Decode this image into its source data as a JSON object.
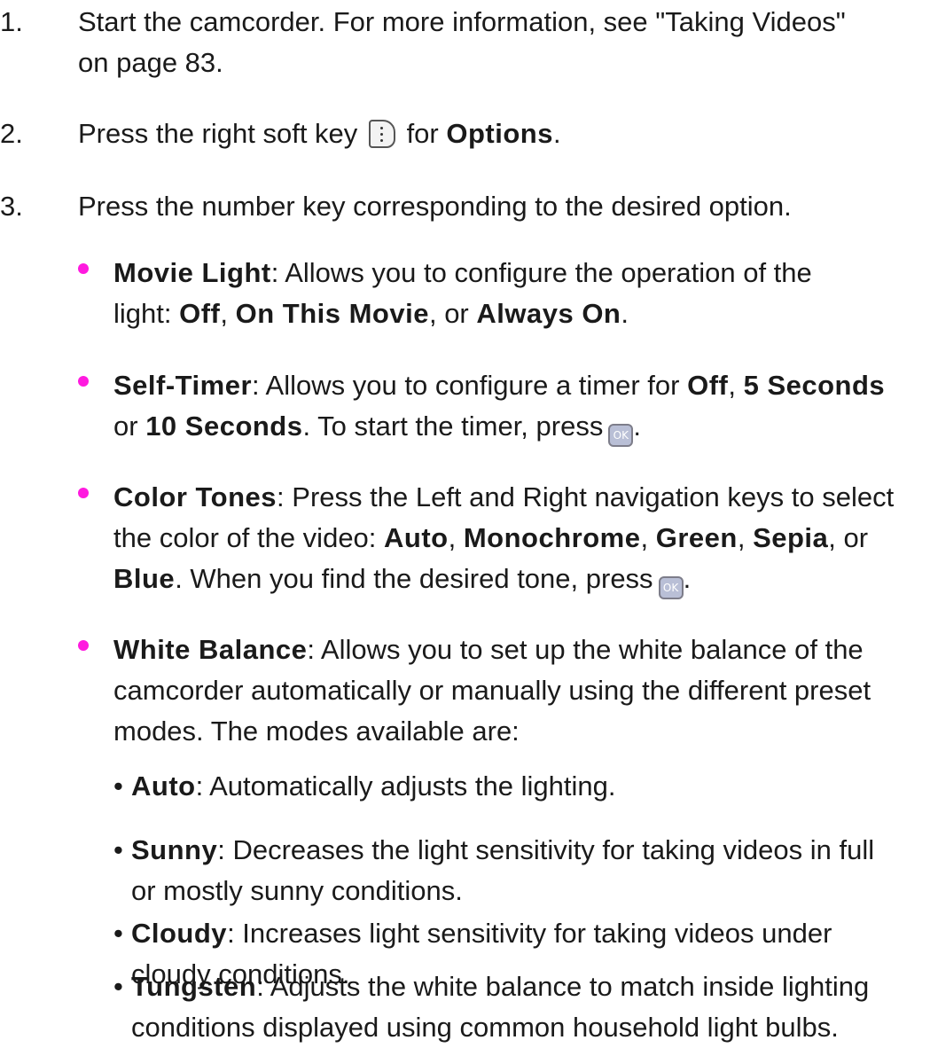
{
  "steps": [
    {
      "num": "1.",
      "line1": "Start the camcorder. For more information, see \"Taking Videos\"",
      "line2": "on page 83."
    },
    {
      "num": "2.",
      "pre": "Press the right soft key",
      "mid": "for",
      "bold": "Options",
      "end": "."
    },
    {
      "num": "3.",
      "text": "Press the number key corresponding to the desired option."
    }
  ],
  "icons": {
    "right_soft_key": "right-soft-key-icon",
    "ok_key": "ok-key-icon",
    "ok_label": "OK"
  },
  "colors": {
    "bullet": "#ff1adf"
  },
  "options": {
    "movie_light": {
      "title": "Movie Light",
      "desc1": ": Allows you to configure the operation of the",
      "desc2": "light: ",
      "v1": "Off",
      "s1": ", ",
      "v2": "On This Movie",
      "s2": ", or ",
      "v3": "Always On",
      "s3": "."
    },
    "self_timer": {
      "title": "Self-Timer",
      "desc1": ": Allows you to configure a timer for ",
      "v1": "Off",
      "s1": ", ",
      "v2": "5 Seconds",
      "s2": "or ",
      "v3": "10 Seconds",
      "s3": ". To start the timer, press",
      "s4": "."
    },
    "color_tones": {
      "title": "Color Tones",
      "desc1": ": Press the Left and Right navigation keys to select",
      "desc2": "the color of the video: ",
      "v1": "Auto",
      "s1": ", ",
      "v2": "Monochrome",
      "s2": ", ",
      "v3": "Green",
      "s3": ", ",
      "v4": "Sepia",
      "s4": ", or",
      "v5": "Blue",
      "s5": ". When you find the desired tone, press",
      "s6": "."
    },
    "white_balance": {
      "title": "White Balance",
      "desc1": ": Allows you to set up the white balance of the",
      "desc2": "camcorder automatically or manually using the different preset",
      "desc3": "modes. The modes available are:"
    }
  },
  "modes": [
    {
      "name": "Auto",
      "line1": ": Automatically adjusts the lighting.",
      "line2": ""
    },
    {
      "name": "Sunny",
      "line1": ": Decreases the light sensitivity for taking videos in full",
      "line2": "or mostly sunny conditions."
    },
    {
      "name": "Cloudy",
      "line1": ": Increases light sensitivity for taking videos under",
      "line2": "cloudy conditions."
    },
    {
      "name": "Tungsten",
      "line1": ": Adjusts the white balance to match inside lighting",
      "line2": "conditions displayed using common household light bulbs."
    }
  ],
  "bullet_char": "•"
}
